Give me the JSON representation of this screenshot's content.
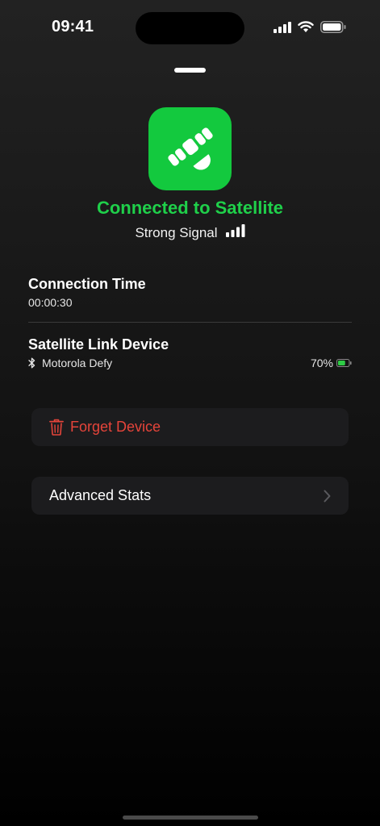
{
  "status_bar": {
    "time": "09:41"
  },
  "header": {
    "title": "Connected to Satellite",
    "signal_label": "Strong Signal",
    "accent_color": "#13c93e"
  },
  "connection": {
    "label": "Connection Time",
    "value": "00:00:30"
  },
  "link_device": {
    "label": "Satellite Link Device",
    "device_name": "Motorola Defy",
    "battery_percent": "70%",
    "battery_level": 0.7
  },
  "actions": {
    "forget_label": "Forget Device",
    "forget_color": "#e5443a",
    "stats_label": "Advanced Stats"
  },
  "icons": [
    "cellular-signal-icon",
    "wifi-icon",
    "battery-icon",
    "satellite-icon",
    "signal-bars-icon",
    "bluetooth-icon",
    "trash-icon",
    "chevron-right-icon"
  ]
}
